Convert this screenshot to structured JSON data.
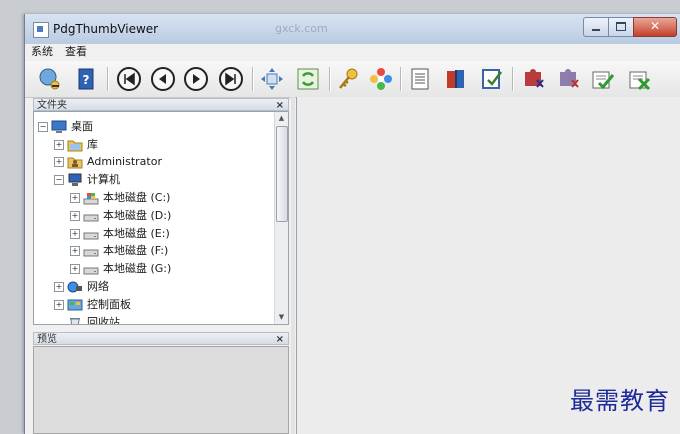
{
  "window": {
    "title": "PdgThumbViewer",
    "faint_url": "gxck.com"
  },
  "titlebar_buttons": {
    "close": "✕"
  },
  "menu": [
    "系统",
    "查看"
  ],
  "toolbar_icons": [
    "connect-icon",
    "help-book-icon",
    "first-page-icon",
    "prev-page-icon",
    "next-page-icon",
    "last-page-icon",
    "fit-icon",
    "refresh-icon",
    "key-icon",
    "flower-icon",
    "document-list-icon",
    "books-icon",
    "check-edit-icon",
    "puzzle-red-icon",
    "puzzle-grey-icon",
    "approve-icon",
    "reject-icon"
  ],
  "folder_panel": {
    "title": "文件夹",
    "close": "×"
  },
  "tree": [
    {
      "label": "桌面",
      "level": 0,
      "expander": "−",
      "icon": "desktop-icon"
    },
    {
      "label": "库",
      "level": 1,
      "expander": "+",
      "icon": "library-icon"
    },
    {
      "label": "Administrator",
      "level": 1,
      "expander": "+",
      "icon": "user-icon"
    },
    {
      "label": "计算机",
      "level": 1,
      "expander": "−",
      "icon": "computer-icon"
    },
    {
      "label": "本地磁盘 (C:)",
      "level": 2,
      "expander": "+",
      "icon": "system-drive-icon"
    },
    {
      "label": "本地磁盘 (D:)",
      "level": 2,
      "expander": "+",
      "icon": "drive-icon"
    },
    {
      "label": "本地磁盘 (E:)",
      "level": 2,
      "expander": "+",
      "icon": "drive-icon"
    },
    {
      "label": "本地磁盘 (F:)",
      "level": 2,
      "expander": "+",
      "icon": "drive-icon"
    },
    {
      "label": "本地磁盘 (G:)",
      "level": 2,
      "expander": "+",
      "icon": "drive-icon"
    },
    {
      "label": "网络",
      "level": 1,
      "expander": "+",
      "icon": "network-icon"
    },
    {
      "label": "控制面板",
      "level": 1,
      "expander": "+",
      "icon": "control-panel-icon"
    },
    {
      "label": "回收站",
      "level": 1,
      "expander": "",
      "icon": "recycle-bin-icon"
    }
  ],
  "preview_panel": {
    "title": "预览",
    "close": "×"
  },
  "watermark": "最需教育"
}
